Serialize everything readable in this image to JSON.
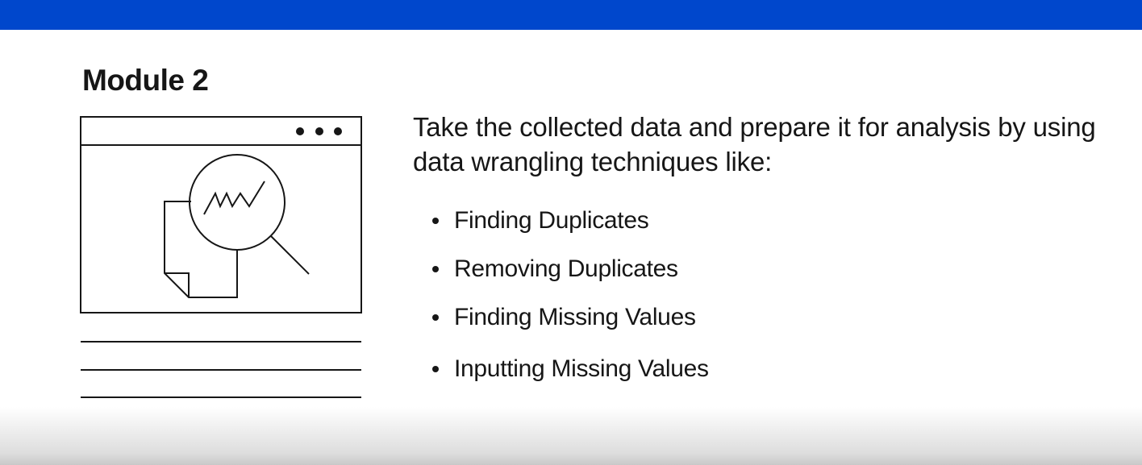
{
  "header": {
    "bar_color": "#0047cc"
  },
  "slide": {
    "title": "Module 2",
    "description": "Take the collected data and prepare it for analysis by using data wrangling techniques like:",
    "techniques": [
      "Finding Duplicates",
      "Removing Duplicates",
      "Finding Missing Values",
      "Inputting Missing Values"
    ]
  },
  "illustration": {
    "icon": "browser-window-data-analysis-icon",
    "sub_icons": [
      "window-menu-dots-icon",
      "document-icon",
      "magnifying-glass-icon",
      "line-chart-icon"
    ]
  }
}
